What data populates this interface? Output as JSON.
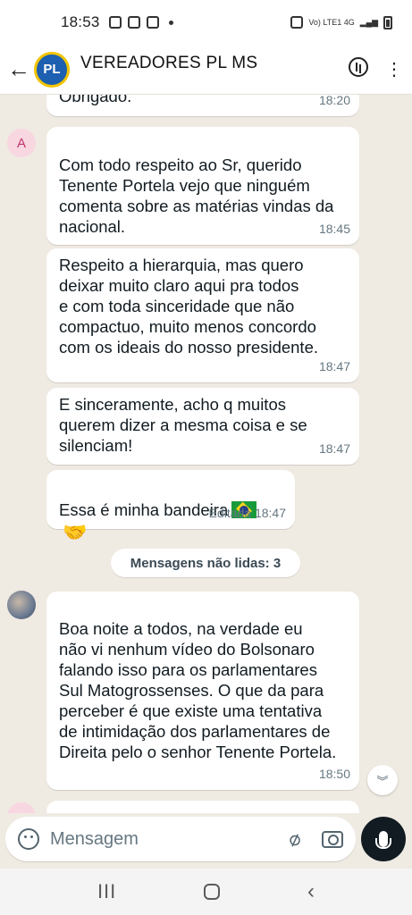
{
  "status_bar": {
    "time": "18:53",
    "network": "Vo) LTE1 4G"
  },
  "header": {
    "avatar_text": "PL",
    "title": "VEREADORES PL MS"
  },
  "messages": [
    {
      "text": "Obrigado.",
      "time": "18:20"
    },
    {
      "avatar_letter": "A",
      "text": "Com todo respeito ao Sr, querido\nTenente Portela vejo que ninguém\ncomenta sobre as matérias vindas da\nnacional.",
      "time": "18:45"
    },
    {
      "text": "Respeito a hierarquia, mas quero\ndeixar muito claro aqui pra todos\ne com toda sinceridade que não\ncompactuo, muito menos concordo\ncom os ideais do nosso presidente.",
      "time": "18:47"
    },
    {
      "text": "E sinceramente, acho q muitos\nquerem dizer a mesma coisa e se\nsilenciam!",
      "time": "18:47"
    },
    {
      "text": "Essa é minha bandeira",
      "emoji": "🤝",
      "time": "Editada 18:47"
    },
    {
      "text": "Boa noite a todos, na verdade eu\nnão vi nenhum vídeo do Bolsonaro\nfalando isso para os parlamentares\nSul Matogrossenses. O que da para\nperceber é que existe uma tentativa\nde intimidação dos parlamentares de\nDireita pelo o senhor Tenente Portela.",
      "time": "18:50"
    }
  ],
  "unread_label": "Mensagens não lidas: 3",
  "input": {
    "placeholder": "Mensagem"
  },
  "nav": {
    "recent": "III",
    "back": "‹"
  }
}
